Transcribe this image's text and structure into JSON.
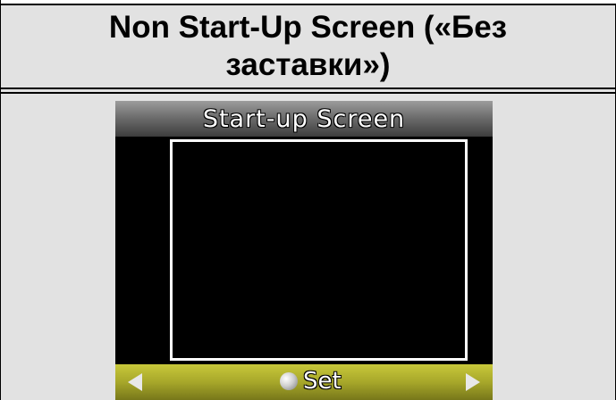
{
  "heading": {
    "text": "Non Start-Up Screen («Без заставки»)"
  },
  "device": {
    "title": "Start-up Screen",
    "footer": {
      "set_label": "Set",
      "left_arrow_icon": "triangle-left-icon",
      "right_arrow_icon": "triangle-right-icon",
      "select_icon": "ball-icon"
    }
  },
  "colors": {
    "page_background": "#e2e2e2",
    "device_background": "#000000",
    "title_bar": "#6e6e6e",
    "footer_bar": "#a7a72a",
    "frame": "#ffffff"
  }
}
